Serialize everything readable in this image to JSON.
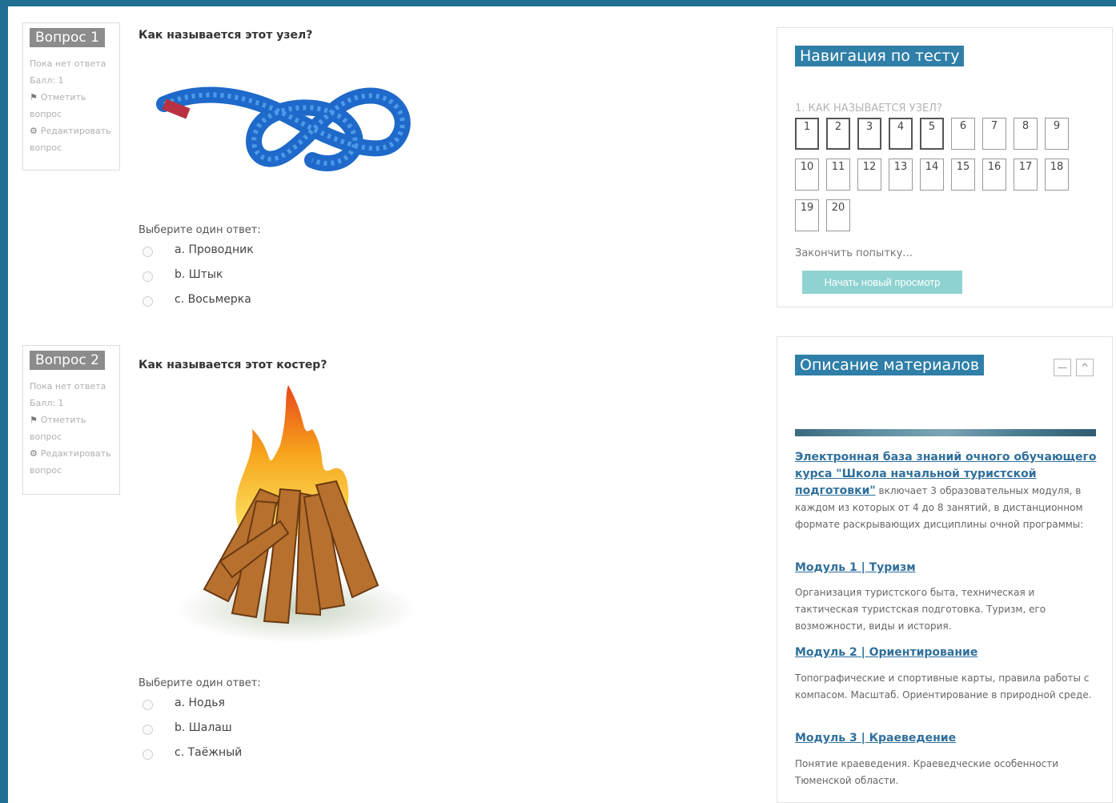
{
  "questions": [
    {
      "badge": "Вопрос 1",
      "status": "Пока нет ответа",
      "score": "Балл: 1",
      "flag": "Отметить вопрос",
      "edit": "Редактировать вопрос",
      "text": "Как называется этот узел?",
      "prompt": "Выберите один ответ:",
      "options": [
        "a. Проводник",
        "b. Штык",
        "c. Восьмерка"
      ]
    },
    {
      "badge": "Вопрос 2",
      "status": "Пока нет ответа",
      "score": "Балл: 1",
      "flag": "Отметить вопрос",
      "edit": "Редактировать вопрос",
      "text": "Как называется этот костер?",
      "prompt": "Выберите один ответ:",
      "options": [
        "a. Нодья",
        "b. Шалаш",
        "c. Таёжный"
      ]
    }
  ],
  "nav": {
    "title": "Навигация по тесту",
    "question_label": "1. КАК НАЗЫВАЕТСЯ УЗЕЛ?",
    "buttons": [
      "1",
      "2",
      "3",
      "4",
      "5",
      "6",
      "7",
      "8",
      "9",
      "10",
      "11",
      "12",
      "13",
      "14",
      "15",
      "16",
      "17",
      "18",
      "19",
      "20"
    ],
    "finish": "Закончить попытку...",
    "new_preview": "Начать новый просмотр"
  },
  "desc": {
    "title": "Описание материалов",
    "collapse_glyph": "—",
    "up_glyph": "^",
    "intro_link": "Электронная база знаний очного обучающего курса \"Школа начальной туристской подготовки\"",
    "intro_text": " включает 3 образовательных модуля, в каждом из которых от 4 до 8 занятий, в дистанционном формате раскрывающих дисциплины очной программы:",
    "modules": [
      {
        "title": "Модуль 1 | Туризм",
        "text": "Организация туристского быта, техническая и тактическая туристская подготовка. Туризм, его возможности, виды и история."
      },
      {
        "title": "Модуль 2 | Ориентирование",
        "text": "Топографические и спортивные карты, правила работы с компасом. Масштаб. Ориентирование в природной среде."
      },
      {
        "title": "Модуль 3 | Краеведение",
        "text": "Понятие краеведения. Краеведческие особенности Тюменской области."
      }
    ]
  },
  "colors": {
    "accent": "#2f7fa8",
    "button": "#8ed3d1",
    "badge": "#8c8c8c",
    "link": "#2f6f9b"
  }
}
